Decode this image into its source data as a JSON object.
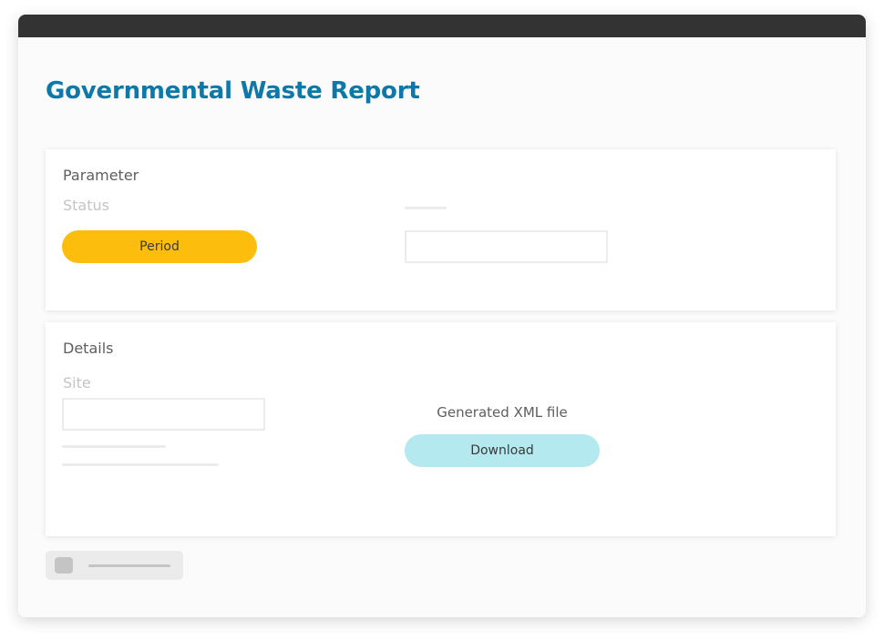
{
  "report": {
    "title": "Governmental Waste Report"
  },
  "parameter_card": {
    "heading": "Parameter",
    "status_label": "Status",
    "period_button": "Period"
  },
  "details_card": {
    "heading": "Details",
    "site_label": "Site",
    "generated_file_label": "Generated XML file",
    "download_button": "Download"
  },
  "colors": {
    "title_blue": "#0e78a8",
    "period_yellow": "#fdbd0d",
    "download_cyan": "#b4e9f0",
    "titlebar_dark": "#333333"
  }
}
